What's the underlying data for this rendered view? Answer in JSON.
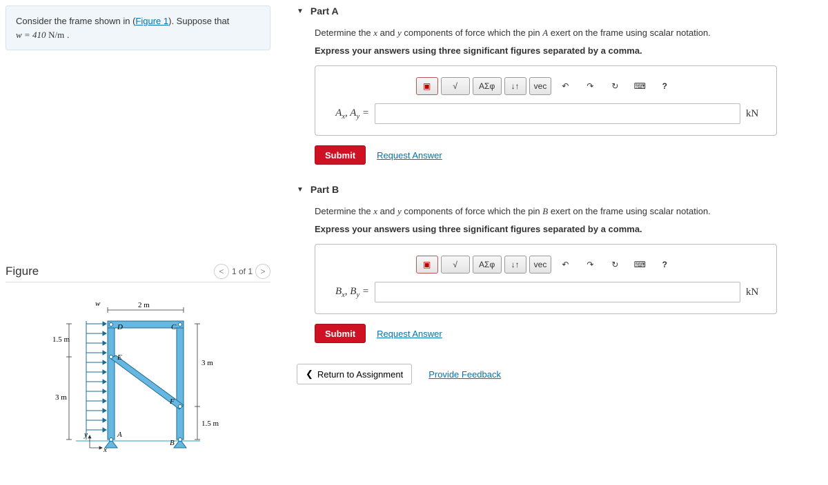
{
  "problem": {
    "text_prefix": "Consider the frame shown in (",
    "figure_link_text": "Figure 1",
    "text_mid": "). Suppose that ",
    "eq_lhs": "w = 410",
    "eq_unit": "N/m",
    "text_suffix": " ."
  },
  "figure": {
    "title": "Figure",
    "nav_label": "1 of 1",
    "prev": "<",
    "next": ">",
    "labels": {
      "w": "w",
      "two_m": "2 m",
      "one_five_m_left": "1.5 m",
      "three_m_left": "3 m",
      "three_m_right": "3 m",
      "one_five_m_right": "1.5 m",
      "A": "A",
      "B": "B",
      "C": "C",
      "D": "D",
      "E": "E",
      "F": "F",
      "x": "x",
      "y": "y"
    }
  },
  "toolbar": {
    "template": "▣",
    "sqrt": "√",
    "greek": "ΑΣφ",
    "supsub": "↓↑",
    "vec": "vec",
    "undo": "↶",
    "redo": "↷",
    "reset": "↻",
    "keyboard": "⌨",
    "help": "?"
  },
  "parts": {
    "a": {
      "title": "Part A",
      "instr_html": "Determine the <span class='math-i'>x</span> and <span class='math-i'>y</span> components of force which the pin <span class='math-i'>A</span> exert on the frame using scalar notation.",
      "instr2": "Express your answers using three significant figures separated by a comma.",
      "var_label_html": "A<sub>x</sub>, A<sub>y</sub> =",
      "unit": "kN",
      "value": "",
      "submit": "Submit",
      "request": "Request Answer"
    },
    "b": {
      "title": "Part B",
      "instr_html": "Determine the <span class='math-i'>x</span> and <span class='math-i'>y</span> components of force which the pin <span class='math-i'>B</span> exert on the frame using scalar notation.",
      "instr2": "Express your answers using three significant figures separated by a comma.",
      "var_label_html": "B<sub>x</sub>, B<sub>y</sub> =",
      "unit": "kN",
      "value": "",
      "submit": "Submit",
      "request": "Request Answer"
    }
  },
  "footer": {
    "return": "Return to Assignment",
    "feedback": "Provide Feedback"
  }
}
